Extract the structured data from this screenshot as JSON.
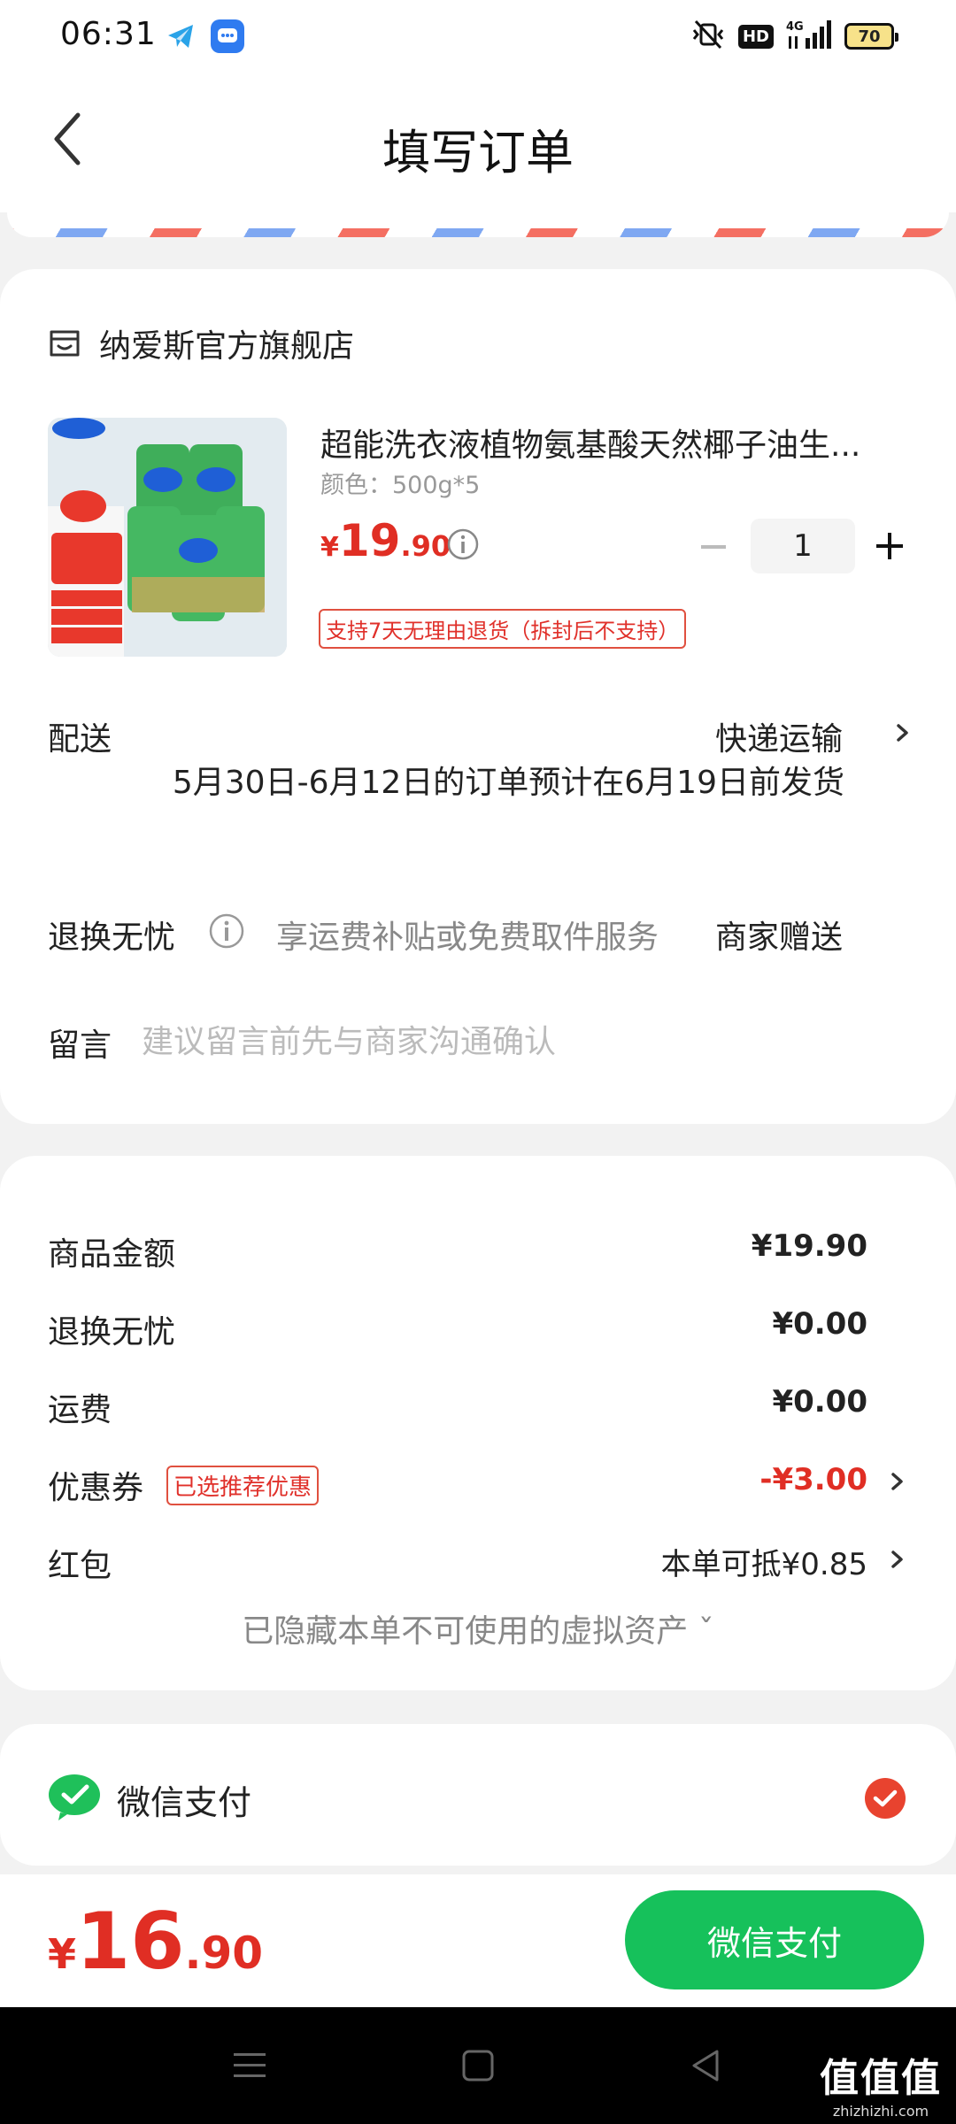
{
  "status_bar": {
    "time": "06:31",
    "hd": "HD",
    "network": "4G",
    "battery": "70"
  },
  "header": {
    "title": "填写订单"
  },
  "store": {
    "name": "纳爱斯官方旗舰店"
  },
  "product": {
    "title": "超能洗衣液植物氨基酸天然椰子油生...",
    "spec": "颜色：500g*5",
    "price_symbol": "¥",
    "price_int": "19",
    "price_dec": ".90",
    "quantity": "1",
    "return_tag": "支持7天无理由退货（拆封后不支持）"
  },
  "delivery": {
    "label": "配送",
    "method": "快递运输",
    "note": "5月30日-6月12日的订单预计在6月19日前发货"
  },
  "returns": {
    "label": "退换无忧",
    "desc": "享运费补贴或免费取件服务",
    "gift": "商家赠送"
  },
  "message": {
    "label": "留言",
    "placeholder": "建议留言前先与商家沟通确认"
  },
  "amounts": {
    "goods_label": "商品金额",
    "goods_value": "¥19.90",
    "returns_label": "退换无忧",
    "returns_value": "¥0.00",
    "shipping_label": "运费",
    "shipping_value": "¥0.00",
    "coupon_label": "优惠券",
    "coupon_tag": "已选推荐优惠",
    "coupon_value": "-¥3.00",
    "redpacket_label": "红包",
    "redpacket_value": "本单可抵¥0.85",
    "hidden_assets": "已隐藏本单不可使用的虚拟资产 ˇ"
  },
  "payment": {
    "method": "微信支付"
  },
  "footer": {
    "total_symbol": "¥",
    "total_int": "16",
    "total_dec": ".90",
    "pay_button": "微信支付"
  },
  "watermark": {
    "main": "值值值",
    "sub": "zhizhizhi.com"
  },
  "colors": {
    "accent_red": "#e02e24",
    "pay_green": "#16c15b"
  }
}
